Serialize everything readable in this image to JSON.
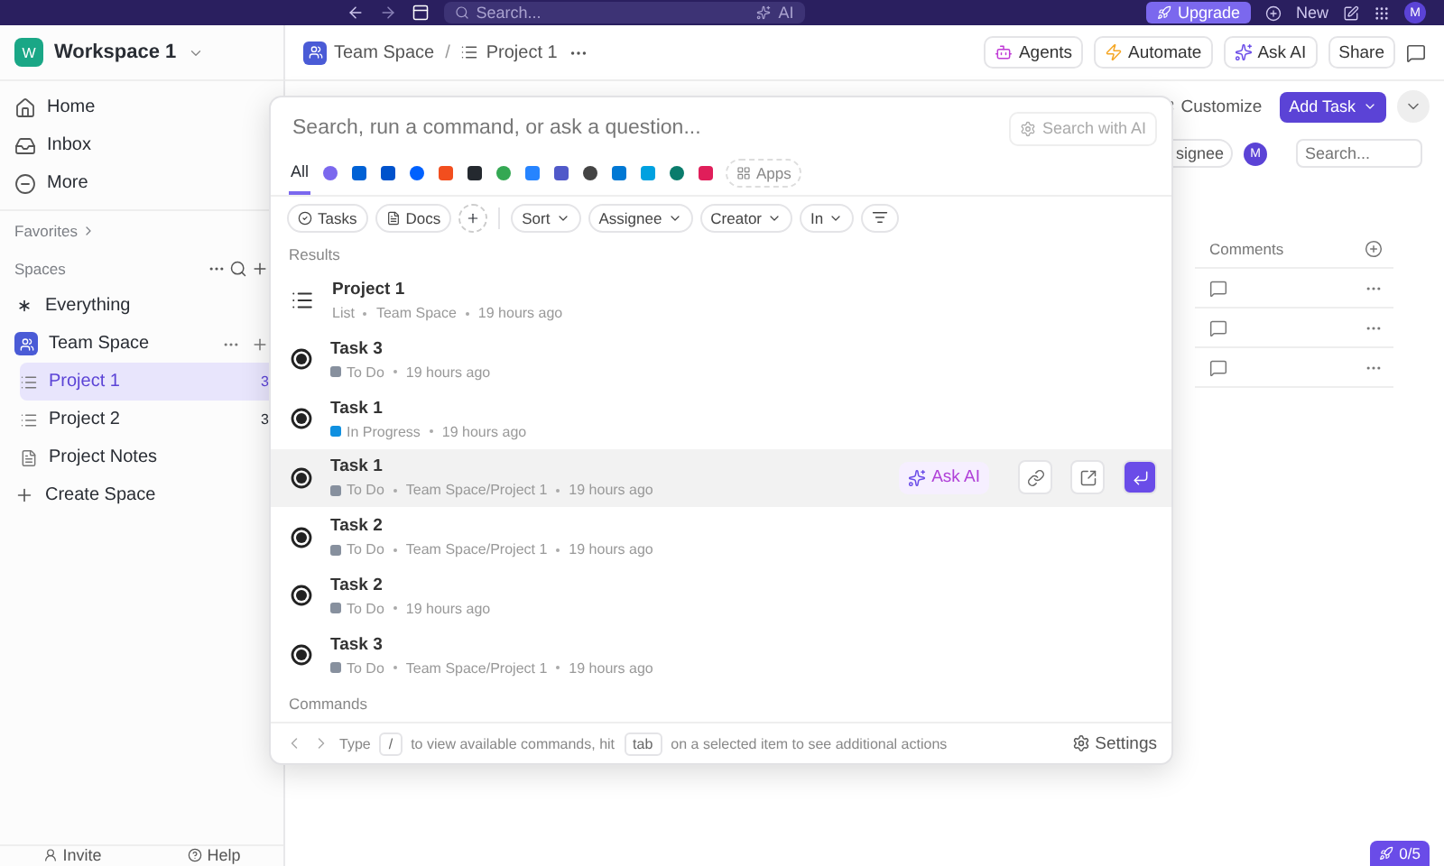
{
  "top_bar": {
    "search_placeholder": "Search...",
    "ai_label": "AI",
    "upgrade": "Upgrade",
    "new": "New",
    "avatar": "M"
  },
  "sidebar": {
    "workspace": {
      "initial": "W",
      "name": "Workspace 1"
    },
    "nav": [
      {
        "label": "Home",
        "kind": "home"
      },
      {
        "label": "Inbox",
        "kind": "inbox"
      },
      {
        "label": "More",
        "kind": "more"
      }
    ],
    "favorites": "Favorites",
    "spaces_label": "Spaces",
    "tree": [
      {
        "label": "Everything",
        "kind": "everything",
        "selected": false
      },
      {
        "label": "Team Space",
        "kind": "space",
        "selected": false,
        "children": [
          {
            "label": "Project 1",
            "kind": "list",
            "count": "3",
            "selected": true
          },
          {
            "label": "Project 2",
            "kind": "list",
            "count": "3",
            "selected": false
          },
          {
            "label": "Project Notes",
            "kind": "doc",
            "selected": false
          }
        ]
      }
    ],
    "create_space": "Create Space",
    "footer": [
      {
        "label": "Invite",
        "kind": "invite"
      },
      {
        "label": "Help",
        "kind": "help"
      }
    ]
  },
  "header": {
    "separator": "/",
    "breadcrumb": [
      {
        "label": "Team Space",
        "kind": "space"
      },
      {
        "label": "Project 1",
        "kind": "list"
      }
    ],
    "actions": [
      {
        "label": "Agents",
        "kind": "agents"
      },
      {
        "label": "Automate",
        "kind": "automate"
      },
      {
        "label": "Ask AI",
        "kind": "ai"
      },
      {
        "label": "Share",
        "kind": "share"
      }
    ]
  },
  "toolbar": {
    "customize": "Customize",
    "add_task": "Add Task",
    "assignee_chip": "signee",
    "avatar": "M",
    "search_placeholder": "Search..."
  },
  "table": {
    "columns": [
      {
        "label": "Comments"
      }
    ]
  },
  "palette": {
    "placeholder": "Search, run a command, or ask a question...",
    "ai_search": "Search with AI",
    "tabs": [
      {
        "label": "All",
        "selected": true
      }
    ],
    "apps_label": "Apps",
    "filters": [
      {
        "label": "Tasks",
        "kind": "tasks"
      },
      {
        "label": "Docs",
        "kind": "docs"
      }
    ],
    "dropdowns": [
      "Sort",
      "Assignee",
      "Creator",
      "In"
    ],
    "results_label": "Results",
    "results": [
      {
        "title": "Project 1",
        "kind": "list",
        "type_label": "List",
        "location": "Team Space",
        "time": "19 hours ago",
        "selected": false
      },
      {
        "title": "Task 3",
        "kind": "task",
        "status": "To Do",
        "color": "#87909e",
        "time": "19 hours ago",
        "selected": false
      },
      {
        "title": "Task 1",
        "kind": "task",
        "status": "In Progress",
        "color": "#1090e0",
        "time": "19 hours ago",
        "selected": false
      },
      {
        "title": "Task 1",
        "kind": "task",
        "status": "To Do",
        "color": "#87909e",
        "location": "Team Space/Project 1",
        "time": "19 hours ago",
        "selected": true
      },
      {
        "title": "Task 2",
        "kind": "task",
        "status": "To Do",
        "color": "#87909e",
        "location": "Team Space/Project 1",
        "time": "19 hours ago",
        "selected": false
      },
      {
        "title": "Task 2",
        "kind": "task",
        "status": "To Do",
        "color": "#87909e",
        "time": "19 hours ago",
        "selected": false
      },
      {
        "title": "Task 3",
        "kind": "task",
        "status": "To Do",
        "color": "#87909e",
        "location": "Team Space/Project 1",
        "time": "19 hours ago",
        "selected": false
      }
    ],
    "row_actions": {
      "ask_ai": "Ask AI"
    },
    "commands_label": "Commands",
    "footer": {
      "type": "Type",
      "key1": "/",
      "middle": "to view available commands, hit",
      "key2": "tab",
      "end": "on a selected item to see additional actions",
      "settings": "Settings"
    }
  },
  "badge": "0/5"
}
